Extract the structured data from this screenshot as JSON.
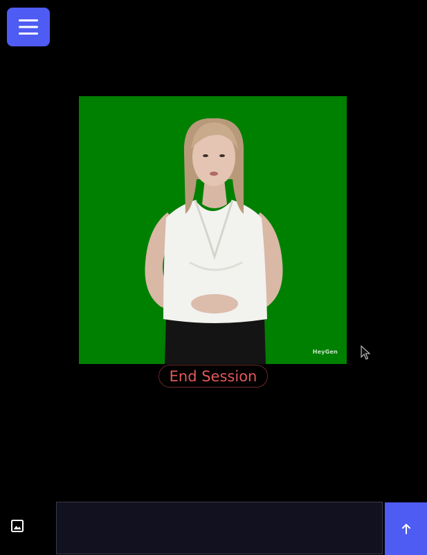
{
  "menu": {
    "icon": "hamburger-menu-icon",
    "color": "#4f5cf3"
  },
  "avatar_video": {
    "background_color": "#008000",
    "watermark": "HeyGen"
  },
  "end_session": {
    "label": "End Session",
    "color": "#e25a5a"
  },
  "composer": {
    "image_button_icon": "image-icon",
    "input_value": "",
    "send_icon": "arrow-up-icon",
    "send_color": "#4f5cf3"
  }
}
